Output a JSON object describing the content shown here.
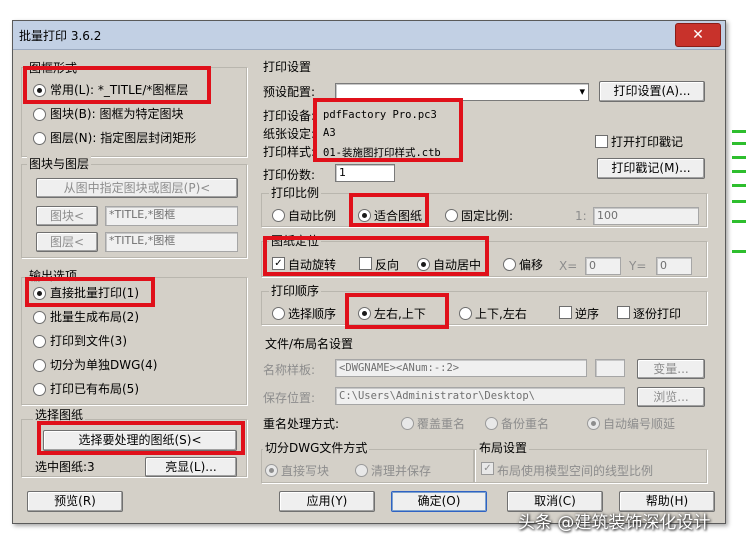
{
  "window": {
    "title": "批量打印 3.6.2",
    "close_icon": "close-x-icon"
  },
  "frame_style": {
    "title": "图框形式",
    "options": [
      {
        "label": "常用(L): *_TITLE/*图框层",
        "selected": true
      },
      {
        "label": "图块(B): 图框为特定图块",
        "selected": false
      },
      {
        "label": "图层(N): 指定图层封闭矩形",
        "selected": false
      }
    ]
  },
  "block_layer": {
    "title": "图块与图层",
    "pick_button": "从图中指定图块或图层(P)<",
    "block_button": "图块<",
    "block_value": "*TITLE,*图框",
    "layer_button": "图层<",
    "layer_value": "*TITLE,*图框"
  },
  "output": {
    "title": "输出选项",
    "options": [
      {
        "label": "直接批量打印(1)",
        "selected": true
      },
      {
        "label": "批量生成布局(2)",
        "selected": false
      },
      {
        "label": "打印到文件(3)",
        "selected": false
      },
      {
        "label": "切分为单独DWG(4)",
        "selected": false
      },
      {
        "label": "打印已有布局(5)",
        "selected": false
      }
    ]
  },
  "select_drawings": {
    "title": "选择图纸",
    "button": "选择要处理的图纸(S)<",
    "count_label": "选中图纸:3",
    "highlight_button": "亮显(L)..."
  },
  "print_settings": {
    "title": "打印设置",
    "preset_label": "预设配置:",
    "preset_value": "",
    "print_setup_button": "打印设置(A)...",
    "device_label": "打印设备:",
    "device_value": "pdfFactory Pro.pc3",
    "paper_label": "纸张设定:",
    "paper_value": "A3",
    "style_label": "打印样式:",
    "style_value": "01-装施图打印样式.ctb",
    "stamp_check_label": "打开打印戳记",
    "stamp_checked": false,
    "stamp_button": "打印戳记(M)...",
    "copies_label": "打印份数:",
    "copies_value": "1"
  },
  "scale": {
    "title": "打印比例",
    "options": [
      {
        "label": "自动比例",
        "selected": false
      },
      {
        "label": "适合图纸",
        "selected": true
      },
      {
        "label": "固定比例:",
        "selected": false
      }
    ],
    "ratio_prefix": "1:",
    "ratio_value": "100"
  },
  "position": {
    "title": "图纸定位",
    "auto_rotate_label": "自动旋转",
    "auto_rotate_checked": true,
    "reverse_label": "反向",
    "reverse_checked": false,
    "center_label": "自动居中",
    "center_selected": true,
    "offset_label": "偏移",
    "offset_selected": false,
    "x_label": "X=",
    "x_value": "0",
    "y_label": "Y=",
    "y_value": "0"
  },
  "order": {
    "title": "打印顺序",
    "options": [
      {
        "label": "选择顺序",
        "selected": false
      },
      {
        "label": "左右,上下",
        "selected": true
      },
      {
        "label": "上下,左右",
        "selected": false
      }
    ],
    "reverse_label": "逆序",
    "per_page_label": "逐份打印"
  },
  "file_layout": {
    "title": "文件/布局名设置",
    "name_label": "名称样板:",
    "name_value": "<DWGNAME><ANum:-:2>",
    "change_button": "变量...",
    "save_label": "保存位置:",
    "save_value": "C:\\Users\\Administrator\\Desktop\\",
    "browse_button": "浏览...",
    "rename_label": "重名处理方式:",
    "rename_options": [
      {
        "label": "覆盖重名",
        "selected": false
      },
      {
        "label": "备份重名",
        "selected": false
      },
      {
        "label": "自动编号顺延",
        "selected": true
      }
    ]
  },
  "split_dwg": {
    "title": "切分DWG文件方式",
    "options": [
      {
        "label": "直接写块",
        "selected": true
      },
      {
        "label": "清理并保存",
        "selected": false
      }
    ]
  },
  "layout_settings": {
    "title": "布局设置",
    "check_label": "布局使用模型空间的线型比例",
    "checked": true
  },
  "footer": {
    "preview": "预览(R)",
    "apply": "应用(Y)",
    "ok": "确定(O)",
    "cancel": "取消(C)",
    "help": "帮助(H)"
  },
  "watermark": "头条 @建筑装饰深化设计",
  "colors": {
    "highlight": "#e0101a",
    "title_bar": "#c2d0e4",
    "dialog": "#d4d0c8"
  }
}
